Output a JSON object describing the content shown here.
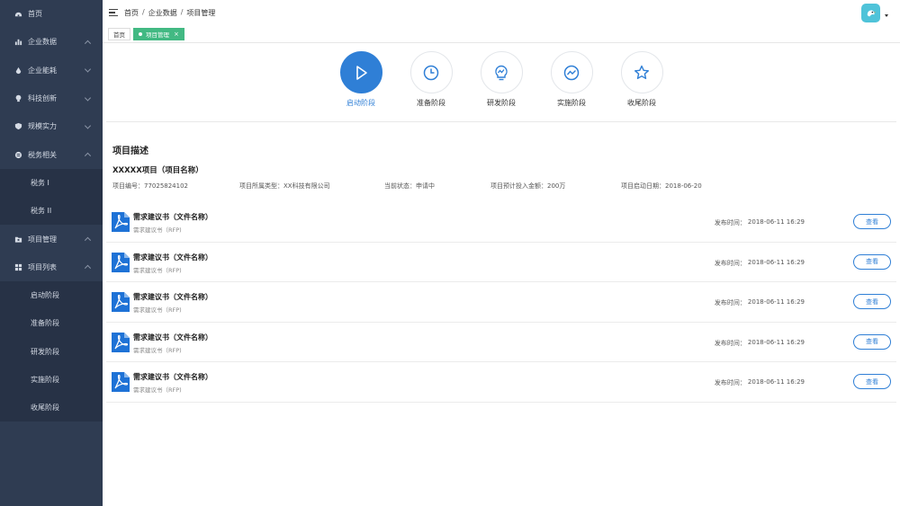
{
  "sidebar": {
    "items": [
      {
        "label": "首页",
        "icon": "dashboard-icon"
      },
      {
        "label": "企业数据",
        "icon": "bar-chart-icon"
      },
      {
        "label": "企业能耗",
        "icon": "drop-icon"
      },
      {
        "label": "科技创新",
        "icon": "bulb-icon"
      },
      {
        "label": "规模实力",
        "icon": "shield-icon"
      },
      {
        "label": "税务相关",
        "icon": "tax-icon"
      },
      {
        "label": "税务 I"
      },
      {
        "label": "税务 II"
      },
      {
        "label": "项目管理",
        "icon": "folder-icon"
      },
      {
        "label": "项目列表",
        "icon": "grid-icon"
      },
      {
        "label": "启动阶段"
      },
      {
        "label": "准备阶段"
      },
      {
        "label": "研发阶段"
      },
      {
        "label": "实施阶段"
      },
      {
        "label": "收尾阶段"
      }
    ]
  },
  "header": {
    "breadcrumb": [
      "首页",
      "企业数据",
      "项目管理"
    ],
    "breadcrumb_sep": "/"
  },
  "tabs": [
    {
      "label": "首页",
      "active": false
    },
    {
      "label": "项目管理",
      "active": true,
      "close": "×"
    }
  ],
  "stages": [
    {
      "label": "启动阶段",
      "icon": "play-icon",
      "active": true
    },
    {
      "label": "准备阶段",
      "icon": "clock-icon",
      "active": false
    },
    {
      "label": "研发阶段",
      "icon": "lightbulb-chart-icon",
      "active": false
    },
    {
      "label": "实施阶段",
      "icon": "trend-icon",
      "active": false
    },
    {
      "label": "收尾阶段",
      "icon": "star-icon",
      "active": false
    }
  ],
  "project": {
    "section_title": "项目描述",
    "name": "XXXXX项目（项目名称）",
    "meta": [
      "项目编号：77025824102",
      "项目所属类型：XX科技有限公司",
      "当前状态：申请中",
      "项目预计投入金额：200万",
      "项目启动日期：2018-06-20"
    ]
  },
  "files": [
    {
      "title": "需求建议书（文件名称）",
      "subtitle": "需求建议书（RFP)",
      "time_label": "发布时间：",
      "time": "2018-06-11 16:29",
      "button": "查看"
    },
    {
      "title": "需求建议书（文件名称）",
      "subtitle": "需求建议书（RFP)",
      "time_label": "发布时间：",
      "time": "2018-06-11 16:29",
      "button": "查看"
    },
    {
      "title": "需求建议书（文件名称）",
      "subtitle": "需求建议书（RFP)",
      "time_label": "发布时间：",
      "time": "2018-06-11 16:29",
      "button": "查看"
    },
    {
      "title": "需求建议书（文件名称）",
      "subtitle": "需求建议书（RFP)",
      "time_label": "发布时间：",
      "time": "2018-06-11 16:29",
      "button": "查看"
    },
    {
      "title": "需求建议书（文件名称）",
      "subtitle": "需求建议书（RFP)",
      "time_label": "发布时间：",
      "time": "2018-06-11 16:29",
      "button": "查看"
    }
  ],
  "colors": {
    "sidebar_bg": "#2f3c52",
    "primary": "#2f7fd6",
    "tag_active": "#42b983",
    "avatar_bg": "#4fc3d9"
  }
}
